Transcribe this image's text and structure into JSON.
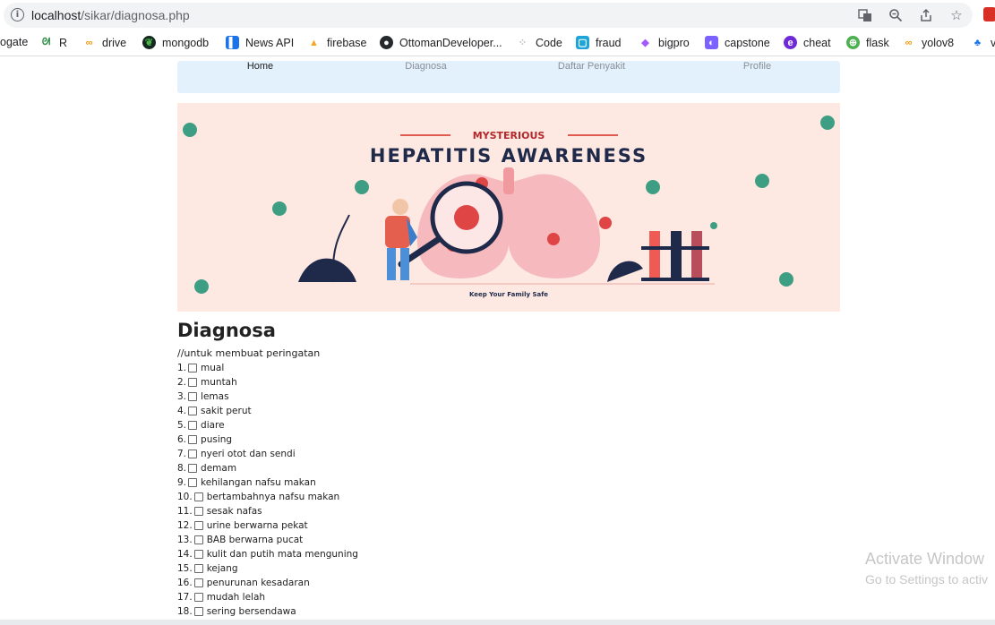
{
  "browser": {
    "url_host": "localhost",
    "url_path": "/sikar/diagnosa.php",
    "bookmarks": [
      {
        "label": "ogate",
        "icon": "bookmark-icon"
      },
      {
        "label": "R",
        "icon": "geeksforgeeks-icon"
      },
      {
        "label": "drive",
        "icon": "infinity-icon"
      },
      {
        "label": "mongodb",
        "icon": "leaf-icon"
      },
      {
        "label": "News API",
        "icon": "newspaper-icon"
      },
      {
        "label": "firebase",
        "icon": "flame-icon"
      },
      {
        "label": "OttomanDeveloper...",
        "icon": "github-icon"
      },
      {
        "label": "Code",
        "icon": "dots-icon"
      },
      {
        "label": "fraud",
        "icon": "square-icon"
      },
      {
        "label": "bigpro",
        "icon": "figma-icon"
      },
      {
        "label": "capstone",
        "icon": "app-icon"
      },
      {
        "label": "cheat",
        "icon": "circle-icon"
      },
      {
        "label": "flask",
        "icon": "globe-icon"
      },
      {
        "label": "yolov8",
        "icon": "infinity-icon"
      },
      {
        "label": "v",
        "icon": "shapes-icon"
      }
    ]
  },
  "nav": {
    "items": [
      {
        "label": "Home"
      },
      {
        "label": "Diagnosa"
      },
      {
        "label": "Daftar Penyakit"
      },
      {
        "label": "Profile"
      }
    ]
  },
  "banner": {
    "kicker": "MYSTERIOUS",
    "title": "HEPATITIS AWARENESS",
    "footer": "Keep Your Family Safe"
  },
  "main": {
    "heading": "Diagnosa",
    "note": "//untuk membuat peringatan",
    "symptoms": [
      {
        "num": "1.",
        "label": "mual"
      },
      {
        "num": "2.",
        "label": "muntah"
      },
      {
        "num": "3.",
        "label": "lemas"
      },
      {
        "num": "4.",
        "label": "sakit perut"
      },
      {
        "num": "5.",
        "label": "diare"
      },
      {
        "num": "6.",
        "label": "pusing"
      },
      {
        "num": "7.",
        "label": "nyeri otot dan sendi"
      },
      {
        "num": "8.",
        "label": "demam"
      },
      {
        "num": "9.",
        "label": "kehilangan nafsu makan"
      },
      {
        "num": "10.",
        "label": "bertambahnya nafsu makan"
      },
      {
        "num": "11.",
        "label": "sesak nafas"
      },
      {
        "num": "12.",
        "label": "urine berwarna pekat"
      },
      {
        "num": "13.",
        "label": "BAB berwarna pucat"
      },
      {
        "num": "14.",
        "label": "kulit dan putih mata menguning"
      },
      {
        "num": "15.",
        "label": "kejang"
      },
      {
        "num": "16.",
        "label": "penurunan kesadaran"
      },
      {
        "num": "17.",
        "label": "mudah lelah"
      },
      {
        "num": "18.",
        "label": "sering bersendawa"
      }
    ]
  },
  "watermark": {
    "line1": "Activate Window",
    "line2": "Go to Settings to activ"
  }
}
